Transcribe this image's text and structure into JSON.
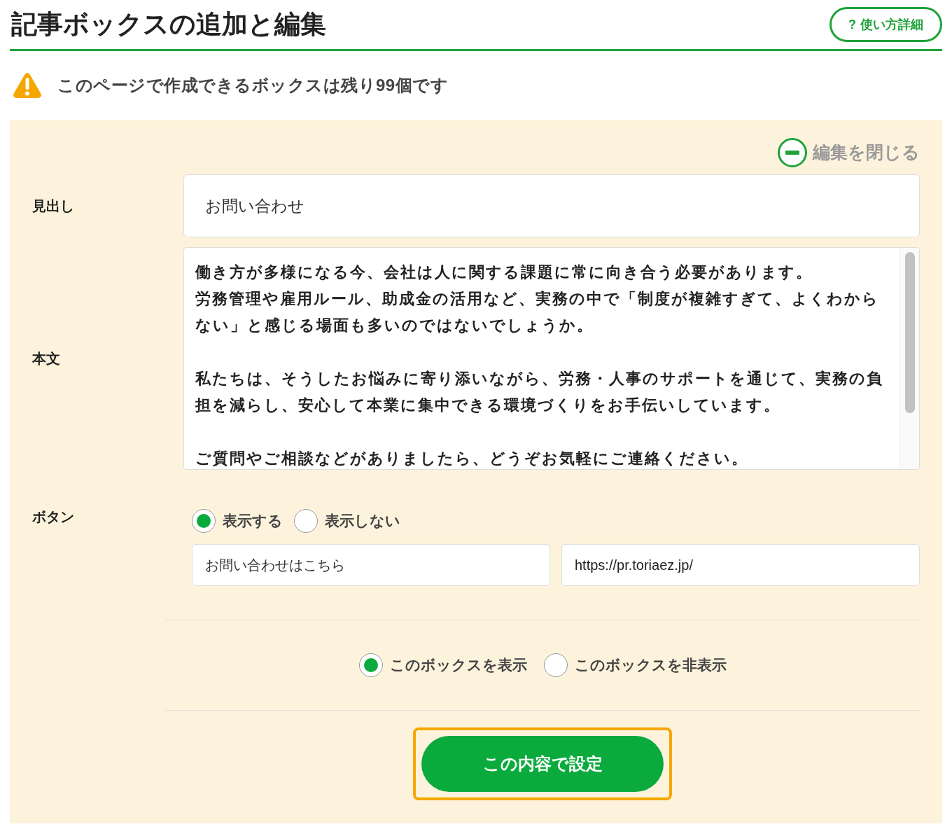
{
  "header": {
    "title": "記事ボックスの追加と編集",
    "help_button": {
      "icon": "?",
      "label": "使い方詳細"
    }
  },
  "notice": {
    "text": "このページで作成できるボックスは残り**99**個です"
  },
  "editor": {
    "close_label": "編集を閉じる",
    "heading": {
      "label": "見出し",
      "value": "お問い合わせ"
    },
    "body": {
      "label": "本文",
      "paragraphs": [
        [
          "働き方が多様になる今、会社は人に関する課題に常に向き合う必要があります。",
          "労務管理や雇用ルール、助成金の活用など、実務の中で「制度が複雑すぎて、よくわからない」と感じる場面も多いのではないでしょうか。"
        ],
        [
          "私たちは、そうしたお悩みに寄り添いながら、労務・人事のサポートを通じて、実務の負担を減らし、安心して本業に集中できる環境づくりをお手伝いしています。"
        ],
        [
          "ご質問やご相談などがありましたら、どうぞお気軽にご連絡ください。"
        ]
      ]
    },
    "button": {
      "label": "ボタン",
      "options": [
        {
          "label": "表示する",
          "selected": true
        },
        {
          "label": "表示しない",
          "selected": false
        }
      ],
      "text_value": "お問い合わせはこちら",
      "url_value": "https://pr.toriaez.jp/"
    },
    "visibility": [
      {
        "label": "このボックスを表示",
        "selected": true
      },
      {
        "label": "このボックスを非表示",
        "selected": false
      }
    ],
    "submit": "この内容で設定"
  }
}
